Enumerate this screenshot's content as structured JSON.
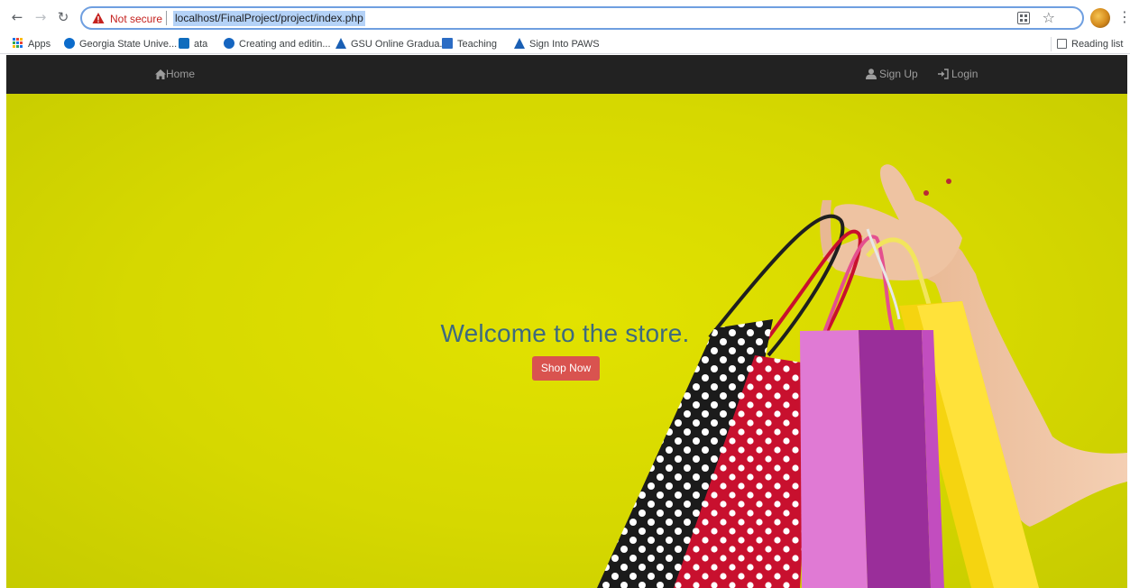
{
  "browser": {
    "security_label": "Not secure",
    "url": "localhost/FinalProject/project/index.php",
    "bookmarks": [
      {
        "label": "Apps",
        "icon": "apps-grid-icon"
      },
      {
        "label": "Georgia State Unive...",
        "icon": "gsu-icon"
      },
      {
        "label": "ata",
        "icon": "outlook-icon"
      },
      {
        "label": "Creating and editin...",
        "icon": "edge-icon"
      },
      {
        "label": "GSU Online Gradua...",
        "icon": "gsu-flame-icon"
      },
      {
        "label": "Teaching",
        "icon": "calendar-icon"
      },
      {
        "label": "Sign Into PAWS",
        "icon": "gsu-flame-icon"
      }
    ],
    "reading_list": "Reading list"
  },
  "site": {
    "nav": {
      "home": "Home",
      "signup": "Sign Up",
      "login": "Login"
    },
    "hero": {
      "title": "Welcome to the store.",
      "button": "Shop Now"
    },
    "colors": {
      "navbar": "#222222",
      "hero_bg": "#d9da00",
      "title": "#3d6a7f",
      "button": "#d9534f"
    }
  }
}
